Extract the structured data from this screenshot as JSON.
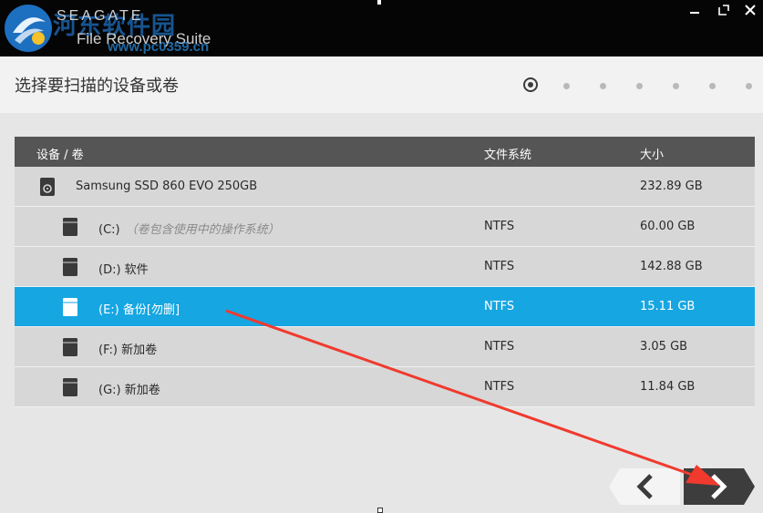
{
  "titlebar": {
    "brand": "SEAGATE",
    "product": "File Recovery Suite",
    "watermark_name": "河东软件园",
    "watermark_url": "www.pc0359.cn"
  },
  "header": {
    "title": "选择要扫描的设备或卷",
    "steps": {
      "total": 7,
      "current": 1
    }
  },
  "table": {
    "columns": {
      "device": "设备 / 卷",
      "filesystem": "文件系统",
      "size": "大小"
    },
    "rows": [
      {
        "name": "Samsung SSD 860 EVO 250GB",
        "note": "",
        "fs": "",
        "size": "232.89 GB",
        "kind": "disk",
        "selected": false
      },
      {
        "name": "(C:)",
        "note": "（卷包含使用中的操作系统）",
        "fs": "NTFS",
        "size": "60.00 GB",
        "kind": "volume",
        "selected": false
      },
      {
        "name": "(D:) 软件",
        "note": "",
        "fs": "NTFS",
        "size": "142.88 GB",
        "kind": "volume",
        "selected": false
      },
      {
        "name": "(E:) 备份[勿删]",
        "note": "",
        "fs": "NTFS",
        "size": "15.11 GB",
        "kind": "volume",
        "selected": true
      },
      {
        "name": "(F:) 新加卷",
        "note": "",
        "fs": "NTFS",
        "size": "3.05 GB",
        "kind": "volume",
        "selected": false
      },
      {
        "name": "(G:) 新加卷",
        "note": "",
        "fs": "NTFS",
        "size": "11.84 GB",
        "kind": "volume",
        "selected": false
      }
    ]
  },
  "icons": {
    "back": "chevron-left-icon",
    "next": "chevron-right-icon",
    "minimize": "minimize-icon",
    "maximize": "maximize-icon",
    "close": "close-icon"
  },
  "colors": {
    "selected_row": "#16a6e2",
    "annotation_arrow": "#f03a2e",
    "header_bar": "#555555"
  }
}
